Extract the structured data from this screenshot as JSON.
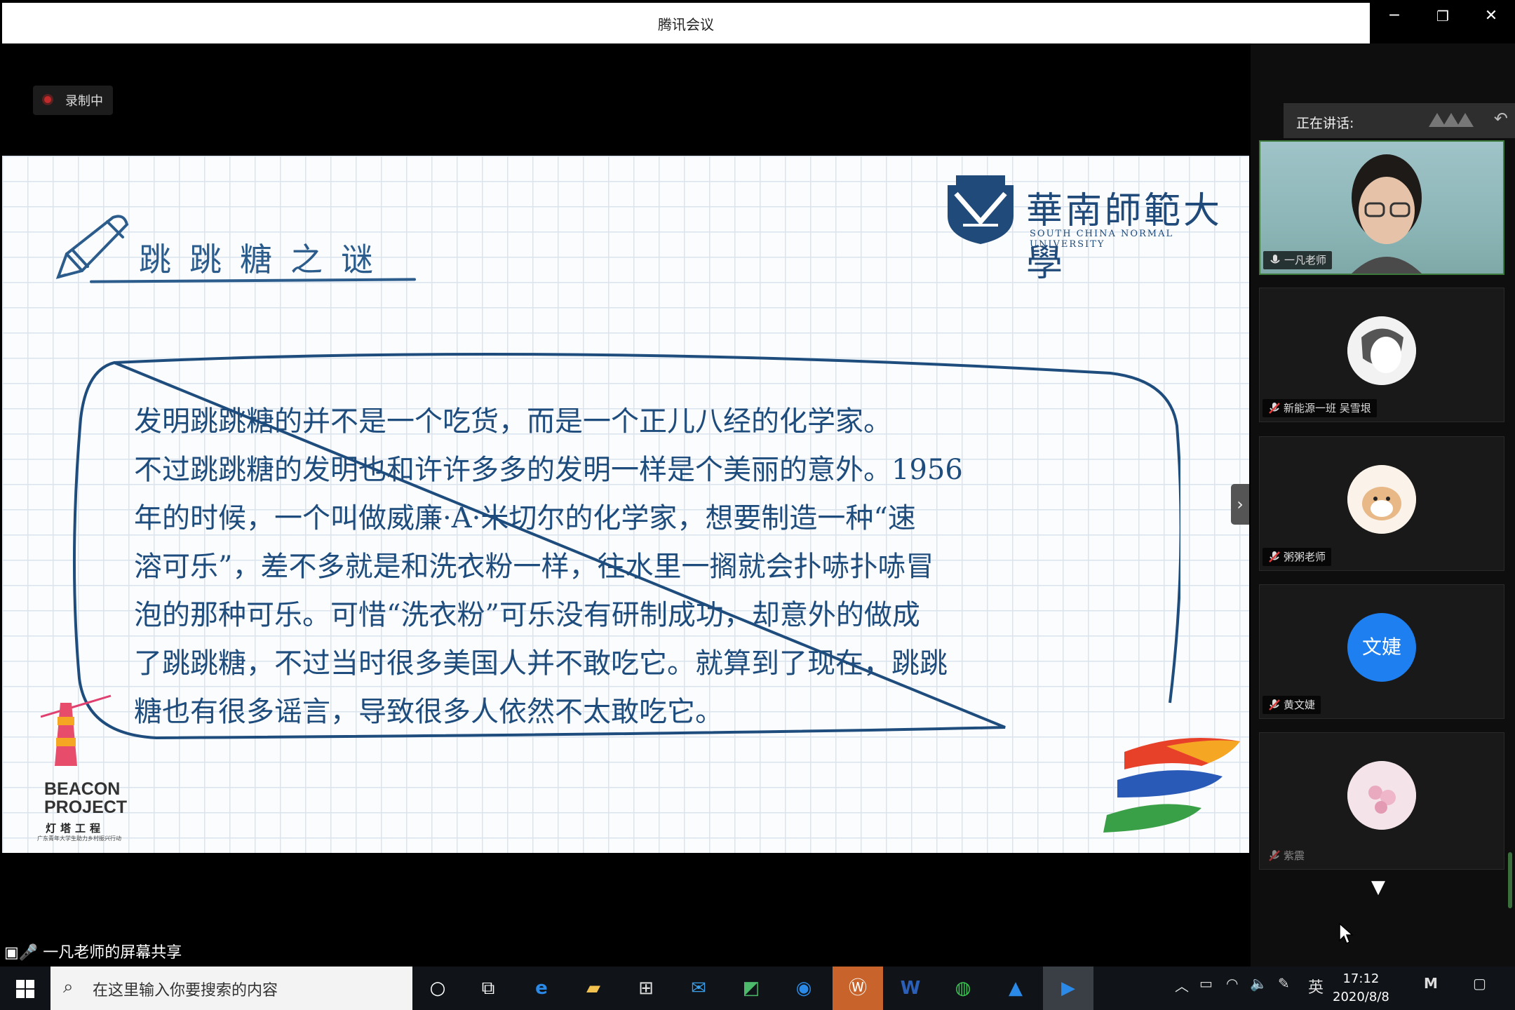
{
  "window": {
    "title": "腾讯会议",
    "minimize": "─",
    "restore": "❐",
    "close": "✕"
  },
  "recording": {
    "label": "录制中"
  },
  "slide": {
    "title": "跳跳糖之谜",
    "university_cn": "華南師範大學",
    "university_en": "SOUTH CHINA NORMAL UNIVERSITY",
    "paragraphs": [
      "发明跳跳糖的并不是一个吃货，而是一个正儿八经的化学家。",
      "不过跳跳糖的发明也和许许多多的发明一样是个美丽的意外。1956",
      "年的时候，一个叫做威廉·A·米切尔的化学家，想要制造一种“速",
      "溶可乐”，差不多就是和洗衣粉一样，往水里一搁就会扑哧扑哧冒",
      "泡的那种可乐。可惜“洗衣粉”可乐没有研制成功，却意外的做成",
      "了跳跳糖，不过当时很多美国人并不敢吃它。就算到了现在，跳跳",
      "糖也有很多谣言，导致很多人依然不太敢吃它。"
    ],
    "beacon_line1": "BEACON",
    "beacon_line2": "PROJECT",
    "beacon_cn": "灯塔工程",
    "beacon_sub": "广东青年大学生助力乡村振兴行动",
    "next_arrow": "›"
  },
  "panel": {
    "speaking_label": "正在讲话:",
    "back_icon": "↶",
    "participants": [
      {
        "name": "一凡老师",
        "mic": "on",
        "type": "video"
      },
      {
        "name": "新能源一班 吴雪垠",
        "mic": "muted",
        "type": "avatar"
      },
      {
        "name": "粥粥老师",
        "mic": "muted",
        "type": "avatar"
      },
      {
        "name": "黄文婕",
        "mic": "muted",
        "type": "initials",
        "initials": "文婕",
        "color": "#1e7ff0"
      },
      {
        "name": "紫震",
        "mic": "muted",
        "type": "avatar"
      }
    ],
    "scroll_down": "▼"
  },
  "share_label": "一凡老师的屏幕共享",
  "taskbar": {
    "search_placeholder": "在这里输入你要搜索的内容",
    "ime": "英",
    "time": "17:12",
    "date": "2020/8/8"
  }
}
